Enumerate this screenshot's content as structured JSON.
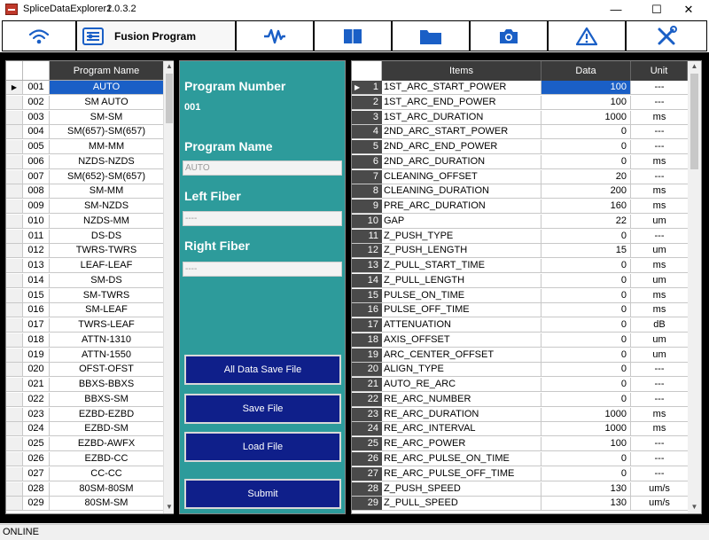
{
  "window": {
    "title": "SpliceDataExplorer2",
    "version": "1.0.3.2",
    "minimize": "—",
    "maximize": "☐",
    "close": "✕"
  },
  "toolbar": {
    "fusion_label": "Fusion Program",
    "icons": [
      "wifi-icon",
      "fusion-program-icon",
      "waveform-icon",
      "book-icon",
      "folder-icon",
      "camera-icon",
      "warning-icon",
      "tools-icon"
    ]
  },
  "colors": {
    "accent": "#1a5fc6",
    "panel": "#2d9b9b",
    "button": "#0f1f8a",
    "header": "#3b3b3b"
  },
  "program_list": {
    "header": "Program Name",
    "selected_marker": "▶",
    "rows": [
      {
        "num": "001",
        "name": "AUTO"
      },
      {
        "num": "002",
        "name": "SM AUTO"
      },
      {
        "num": "003",
        "name": "SM-SM"
      },
      {
        "num": "004",
        "name": "SM(657)-SM(657)"
      },
      {
        "num": "005",
        "name": "MM-MM"
      },
      {
        "num": "006",
        "name": "NZDS-NZDS"
      },
      {
        "num": "007",
        "name": "SM(652)-SM(657)"
      },
      {
        "num": "008",
        "name": "SM-MM"
      },
      {
        "num": "009",
        "name": "SM-NZDS"
      },
      {
        "num": "010",
        "name": "NZDS-MM"
      },
      {
        "num": "011",
        "name": "DS-DS"
      },
      {
        "num": "012",
        "name": "TWRS-TWRS"
      },
      {
        "num": "013",
        "name": "LEAF-LEAF"
      },
      {
        "num": "014",
        "name": "SM-DS"
      },
      {
        "num": "015",
        "name": "SM-TWRS"
      },
      {
        "num": "016",
        "name": "SM-LEAF"
      },
      {
        "num": "017",
        "name": "TWRS-LEAF"
      },
      {
        "num": "018",
        "name": "ATTN-1310"
      },
      {
        "num": "019",
        "name": "ATTN-1550"
      },
      {
        "num": "020",
        "name": "OFST-OFST"
      },
      {
        "num": "021",
        "name": "BBXS-BBXS"
      },
      {
        "num": "022",
        "name": "BBXS-SM"
      },
      {
        "num": "023",
        "name": "EZBD-EZBD"
      },
      {
        "num": "024",
        "name": "EZBD-SM"
      },
      {
        "num": "025",
        "name": "EZBD-AWFX"
      },
      {
        "num": "026",
        "name": "EZBD-CC"
      },
      {
        "num": "027",
        "name": "CC-CC"
      },
      {
        "num": "028",
        "name": "80SM-80SM"
      },
      {
        "num": "029",
        "name": "80SM-SM"
      }
    ]
  },
  "program_detail": {
    "number_label": "Program Number",
    "number_value": "001",
    "name_label": "Program Name",
    "name_value": "AUTO",
    "left_fiber_label": "Left Fiber",
    "left_fiber_value": "----",
    "right_fiber_label": "Right Fiber",
    "right_fiber_value": "----",
    "buttons": {
      "all_data_save": "All Data Save File",
      "save": "Save File",
      "load": "Load File",
      "submit": "Submit"
    }
  },
  "data_table": {
    "headers": {
      "items": "Items",
      "data": "Data",
      "unit": "Unit"
    },
    "selected_marker": "▶",
    "rows": [
      {
        "n": "1",
        "item": "1ST_ARC_START_POWER",
        "data": "100",
        "unit": "---"
      },
      {
        "n": "2",
        "item": "1ST_ARC_END_POWER",
        "data": "100",
        "unit": "---"
      },
      {
        "n": "3",
        "item": "1ST_ARC_DURATION",
        "data": "1000",
        "unit": "ms"
      },
      {
        "n": "4",
        "item": "2ND_ARC_START_POWER",
        "data": "0",
        "unit": "---"
      },
      {
        "n": "5",
        "item": "2ND_ARC_END_POWER",
        "data": "0",
        "unit": "---"
      },
      {
        "n": "6",
        "item": "2ND_ARC_DURATION",
        "data": "0",
        "unit": "ms"
      },
      {
        "n": "7",
        "item": "CLEANING_OFFSET",
        "data": "20",
        "unit": "---"
      },
      {
        "n": "8",
        "item": "CLEANING_DURATION",
        "data": "200",
        "unit": "ms"
      },
      {
        "n": "9",
        "item": "PRE_ARC_DURATION",
        "data": "160",
        "unit": "ms"
      },
      {
        "n": "10",
        "item": "GAP",
        "data": "22",
        "unit": "um"
      },
      {
        "n": "11",
        "item": "Z_PUSH_TYPE",
        "data": "0",
        "unit": "---"
      },
      {
        "n": "12",
        "item": "Z_PUSH_LENGTH",
        "data": "15",
        "unit": "um"
      },
      {
        "n": "13",
        "item": "Z_PULL_START_TIME",
        "data": "0",
        "unit": "ms"
      },
      {
        "n": "14",
        "item": "Z_PULL_LENGTH",
        "data": "0",
        "unit": "um"
      },
      {
        "n": "15",
        "item": "PULSE_ON_TIME",
        "data": "0",
        "unit": "ms"
      },
      {
        "n": "16",
        "item": "PULSE_OFF_TIME",
        "data": "0",
        "unit": "ms"
      },
      {
        "n": "17",
        "item": "ATTENUATION",
        "data": "0",
        "unit": "dB"
      },
      {
        "n": "18",
        "item": "AXIS_OFFSET",
        "data": "0",
        "unit": "um"
      },
      {
        "n": "19",
        "item": "ARC_CENTER_OFFSET",
        "data": "0",
        "unit": "um"
      },
      {
        "n": "20",
        "item": "ALIGN_TYPE",
        "data": "0",
        "unit": "---"
      },
      {
        "n": "21",
        "item": "AUTO_RE_ARC",
        "data": "0",
        "unit": "---"
      },
      {
        "n": "22",
        "item": "RE_ARC_NUMBER",
        "data": "0",
        "unit": "---"
      },
      {
        "n": "23",
        "item": "RE_ARC_DURATION",
        "data": "1000",
        "unit": "ms"
      },
      {
        "n": "24",
        "item": "RE_ARC_INTERVAL",
        "data": "1000",
        "unit": "ms"
      },
      {
        "n": "25",
        "item": "RE_ARC_POWER",
        "data": "100",
        "unit": "---"
      },
      {
        "n": "26",
        "item": "RE_ARC_PULSE_ON_TIME",
        "data": "0",
        "unit": "---"
      },
      {
        "n": "27",
        "item": "RE_ARC_PULSE_OFF_TIME",
        "data": "0",
        "unit": "---"
      },
      {
        "n": "28",
        "item": "Z_PUSH_SPEED",
        "data": "130",
        "unit": "um/s"
      },
      {
        "n": "29",
        "item": "Z_PULL_SPEED",
        "data": "130",
        "unit": "um/s"
      }
    ]
  },
  "status": {
    "text": "ONLINE"
  }
}
